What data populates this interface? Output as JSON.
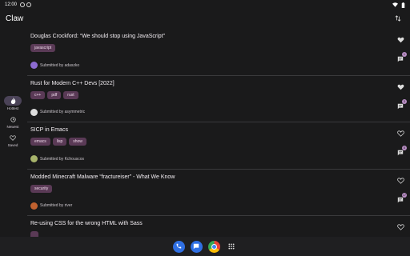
{
  "status": {
    "time": "12:00"
  },
  "app": {
    "title": "Claw"
  },
  "rail": [
    {
      "label": "Hottest",
      "icon": "flame-icon",
      "active": true
    },
    {
      "label": "Newest",
      "icon": "clock-icon",
      "active": false
    },
    {
      "label": "Saved",
      "icon": "heart-icon",
      "active": false
    }
  ],
  "posts": [
    {
      "title": "Douglas Crockford: “We should stop using JavaScript”",
      "tags": [
        "javascript"
      ],
      "submitted": "Submitted by adaszko",
      "saved": true,
      "comments": "1",
      "avatar_color": "#8c6bd1"
    },
    {
      "title": "Rust for Modern C++ Devs [2022]",
      "tags": [
        "c++",
        "pdf",
        "rust"
      ],
      "submitted": "Submitted by asymmetric",
      "saved": true,
      "comments": "3",
      "avatar_color": "#dddddd"
    },
    {
      "title": "SICP in Emacs",
      "tags": [
        "emacs",
        "lisp",
        "show"
      ],
      "submitted": "Submitted by Kchouscos",
      "saved": false,
      "comments": "8",
      "avatar_color": "#a7b36b"
    },
    {
      "title": "Modded Minecraft Malware “fractureiser” - What We Know",
      "tags": [
        "security"
      ],
      "submitted": "Submitted by river",
      "saved": false,
      "comments": "17",
      "avatar_color": "#c0612f"
    },
    {
      "title": "Re-using CSS for the wrong HTML with Sass",
      "tags": [
        ""
      ],
      "submitted": "",
      "saved": false,
      "comments": "",
      "avatar_color": "#666666"
    }
  ],
  "colors": {
    "background": "#1a1a1b",
    "tag_bg": "#5a3a56",
    "rail_active": "#4b4358",
    "badge": "#b88dc4"
  }
}
